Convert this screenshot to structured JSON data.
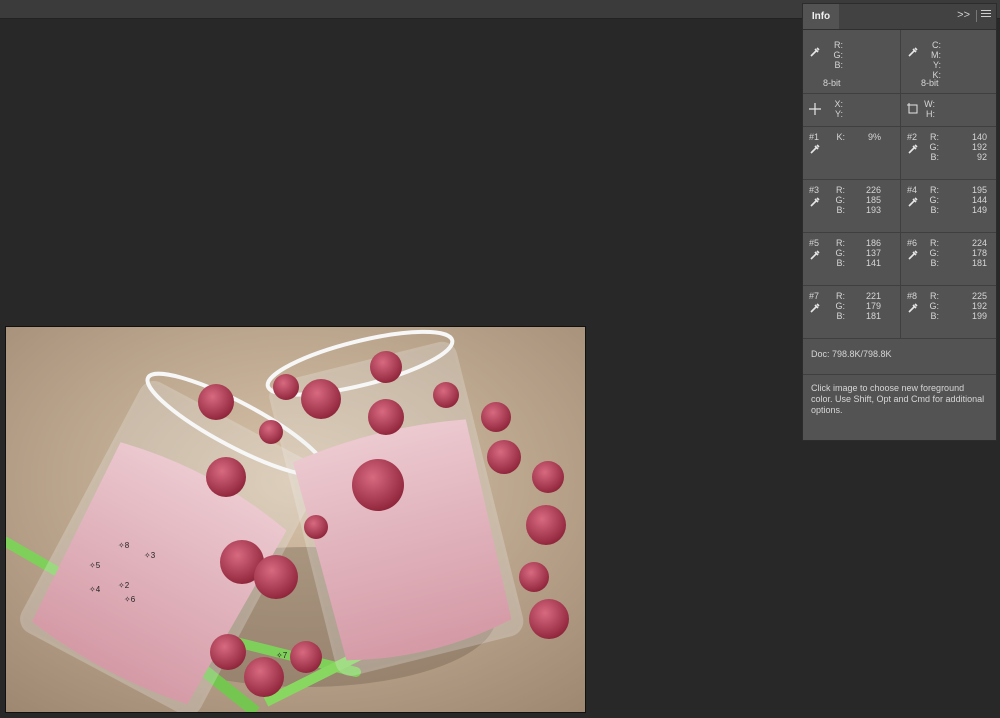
{
  "panel": {
    "tab_label": "Info",
    "collapse_icon": ">>",
    "rgb_labels": [
      "R:",
      "G:",
      "B:"
    ],
    "cmyk_labels": [
      "C:",
      "M:",
      "Y:",
      "K:"
    ],
    "bit_left": "8-bit",
    "bit_right": "8-bit",
    "xy_labels": [
      "X:",
      "Y:"
    ],
    "wh_labels": [
      "W:",
      "H:"
    ],
    "samples": [
      {
        "num": "#1",
        "labels": [
          "K:"
        ],
        "values": [
          "9%"
        ]
      },
      {
        "num": "#2",
        "labels": [
          "R:",
          "G:",
          "B:"
        ],
        "values": [
          "140",
          "192",
          "92"
        ]
      },
      {
        "num": "#3",
        "labels": [
          "R:",
          "G:",
          "B:"
        ],
        "values": [
          "226",
          "185",
          "193"
        ]
      },
      {
        "num": "#4",
        "labels": [
          "R:",
          "G:",
          "B:"
        ],
        "values": [
          "195",
          "144",
          "149"
        ]
      },
      {
        "num": "#5",
        "labels": [
          "R:",
          "G:",
          "B:"
        ],
        "values": [
          "186",
          "137",
          "141"
        ]
      },
      {
        "num": "#6",
        "labels": [
          "R:",
          "G:",
          "B:"
        ],
        "values": [
          "224",
          "178",
          "181"
        ]
      },
      {
        "num": "#7",
        "labels": [
          "R:",
          "G:",
          "B:"
        ],
        "values": [
          "221",
          "179",
          "181"
        ]
      },
      {
        "num": "#8",
        "labels": [
          "R:",
          "G:",
          "B:"
        ],
        "values": [
          "225",
          "192",
          "199"
        ]
      }
    ],
    "doc": "Doc: 798.8K/798.8K",
    "help": "Click image to choose new foreground color.  Use Shift, Opt and Cmd for additional options."
  },
  "markers": [
    "8",
    "3",
    "5",
    "2",
    "4",
    "6",
    "7"
  ],
  "colors": {
    "app_bg": "#282828",
    "panel_bg": "#535353",
    "milk": "#e2b9c1",
    "raspberry": "#b3354c",
    "straw": "#7fd05a",
    "sand": "#c9b39a"
  }
}
